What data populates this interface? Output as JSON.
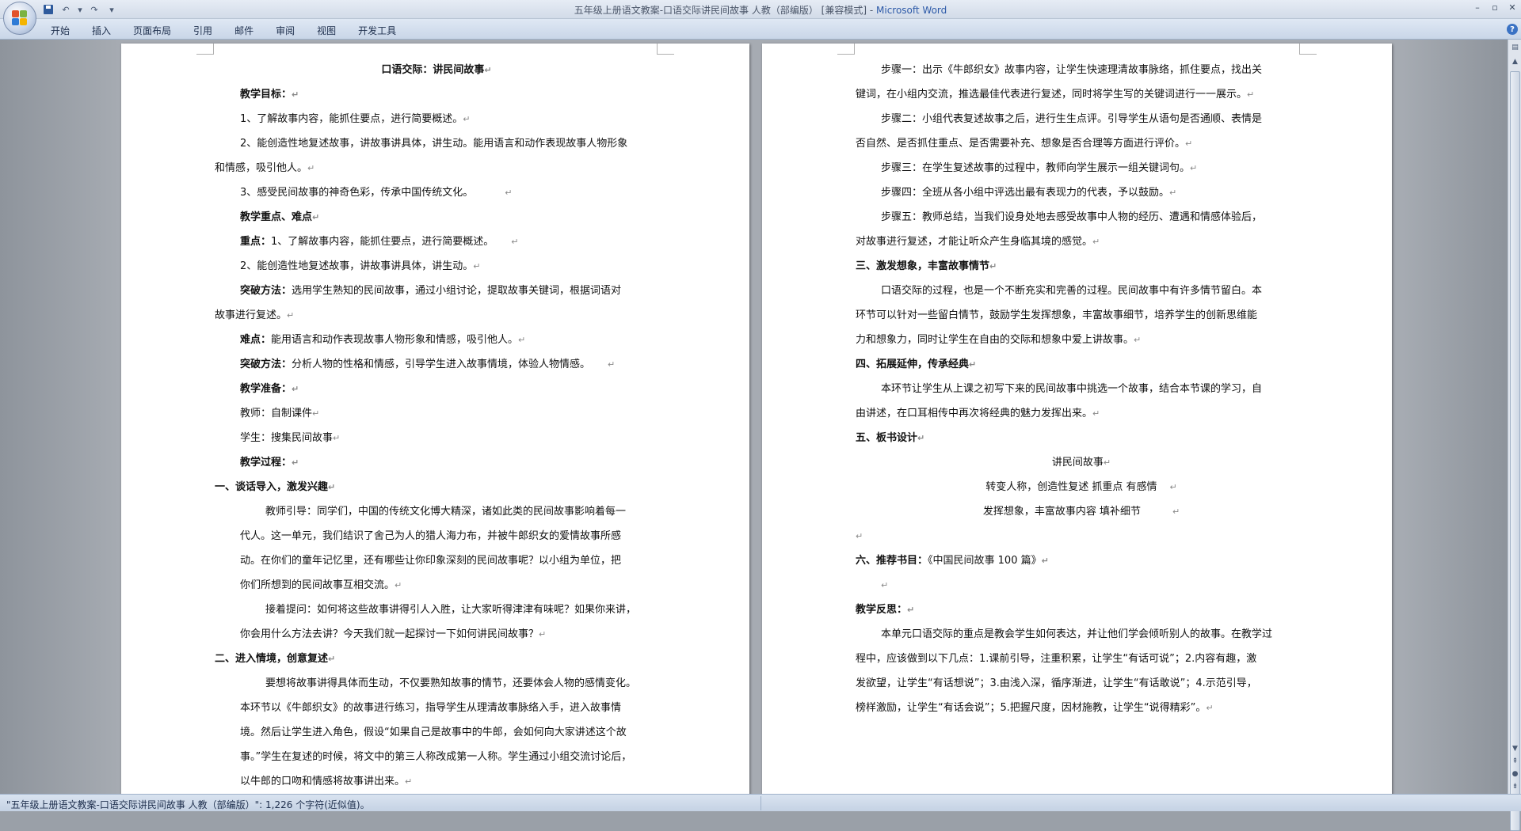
{
  "window": {
    "title_doc": "五年级上册语文教案-口语交际讲民间故事  人教（部编版） [兼容模式] - ",
    "title_app": "Microsoft Word",
    "qat_save": "",
    "qat_undo": "↶",
    "qat_undo_arrow": "▾",
    "qat_redo": "↷",
    "qat_customize": "▾",
    "minimize": "–",
    "maximize": "▫",
    "close": "✕"
  },
  "ribbon": {
    "tabs": [
      "开始",
      "插入",
      "页面布局",
      "引用",
      "邮件",
      "审阅",
      "视图",
      "开发工具"
    ],
    "help": "?"
  },
  "left_page": {
    "title": "口语交际：讲民间故事",
    "goals_heading": "教学目标：",
    "goal1": "1、了解故事内容，能抓住要点，进行简要概述。",
    "goal2_a": "2、能创造性地复述故事，讲故事讲具体，讲生动。能用语言和动作表现故事人物形象",
    "goal2_b": "和情感，吸引他人。",
    "goal3": "3、感受民间故事的神奇色彩，传承中国传统文化。",
    "key_heading": "教学重点、难点",
    "key_label": "重点：",
    "key_text": "1、了解故事内容，能抓住要点，进行简要概述。",
    "key2": "2、能创造性地复述故事，讲故事讲具体，讲生动。",
    "break1_label": "突破方法：",
    "break1_text_a": "选用学生熟知的民间故事，通过小组讨论，提取故事关键词，根据词语对",
    "break1_text_b": "故事进行复述。",
    "diff_label": "难点：",
    "diff_text": "能用语言和动作表现故事人物形象和情感，吸引他人。",
    "break2_label": "突破方法：",
    "break2_text": "分析人物的性格和情感，引导学生进入故事情境，体验人物情感。",
    "prep_heading": "教学准备：",
    "prep_teacher": "教师：自制课件",
    "prep_student": "学生：搜集民间故事",
    "process_heading": "教学过程：",
    "sec1_heading": "一、谈话导入，激发兴趣",
    "sec1_p1": [
      "教师引导：同学们，中国的传统文化博大精深，诸如此类的民间故事影响着每一",
      "代人。这一单元，我们结识了舍己为人的猎人海力布，并被牛郎织女的爱情故事所感",
      "动。在你们的童年记忆里，还有哪些让你印象深刻的民间故事呢？以小组为单位，把",
      "你们所想到的民间故事互相交流。"
    ],
    "sec1_p2": [
      "接着提问：如何将这些故事讲得引人入胜，让大家听得津津有味呢？如果你来讲，",
      "你会用什么方法去讲？今天我们就一起探讨一下如何讲民间故事？"
    ],
    "sec2_heading": "二、进入情境，创意复述",
    "sec2_p1": [
      "要想将故事讲得具体而生动，不仅要熟知故事的情节，还要体会人物的感情变化。",
      "本环节以《牛郎织女》的故事进行练习，指导学生从理清故事脉络入手，进入故事情",
      "境。然后让学生进入角色，假设“如果自己是故事中的牛郎，会如何向大家讲述这个故",
      "事。”学生在复述的时候，将文中的第三人称改成第一人称。学生通过小组交流讨论后，",
      "以牛郎的口吻和情感将故事讲出来。"
    ]
  },
  "right_page": {
    "step1": [
      "步骤一：出示《牛郎织女》故事内容，让学生快速理清故事脉络，抓住要点，找出关",
      "键词，在小组内交流，推选最佳代表进行复述，同时将学生写的关键词进行一一展示。"
    ],
    "step2": [
      "步骤二：小组代表复述故事之后，进行生生点评。引导学生从语句是否通顺、表情是",
      "否自然、是否抓住重点、是否需要补充、想象是否合理等方面进行评价。"
    ],
    "step3": "步骤三：在学生复述故事的过程中，教师向学生展示一组关键词句。",
    "step4": "步骤四：全班从各小组中评选出最有表现力的代表，予以鼓励。",
    "step5": [
      "步骤五：教师总结，当我们设身处地去感受故事中人物的经历、遭遇和情感体验后，",
      "对故事进行复述，才能让听众产生身临其境的感觉。"
    ],
    "sec3_heading": "三、激发想象，丰富故事情节",
    "sec3_p": [
      "口语交际的过程，也是一个不断充实和完善的过程。民间故事中有许多情节留白。本",
      "环节可以针对一些留白情节，鼓励学生发挥想象，丰富故事细节，培养学生的创新思维能",
      "力和想象力，同时让学生在自由的交际和想象中爱上讲故事。"
    ],
    "sec4_heading": "四、拓展延伸，传承经典",
    "sec4_p": [
      "本环节让学生从上课之初写下来的民间故事中挑选一个故事，结合本节课的学习，自",
      "由讲述，在口耳相传中再次将经典的魅力发挥出来。"
    ],
    "sec5_heading": "五、板书设计",
    "board_title": "讲民间故事",
    "board_line1": "转变人称，创造性复述     抓重点   有感情",
    "board_line2": "发挥想象，丰富故事内容     填补细节",
    "sec6_heading": "六、推荐书目：",
    "sec6_text": "《中国民间故事 100 篇》",
    "reflect_heading": "教学反思：",
    "reflect_p": [
      "本单元口语交际的重点是教会学生如何表达，并让他们学会倾听别人的故事。在教学过",
      "程中，应该做到以下几点：1.课前引导，注重积累，让学生“有话可说”；2.内容有趣，激",
      "发欲望，让学生“有话想说”；3.由浅入深，循序渐进，让学生“有话敢说”；4.示范引导，",
      "榜样激励，让学生“有话会说”；5.把握尺度，因材施教，让学生“说得精彩”。"
    ]
  },
  "status": {
    "text": "\"五年级上册语文教案-口语交际讲民间故事  人教（部编版）\": 1,226 个字符(近似值)。"
  },
  "para_mark": "↵"
}
